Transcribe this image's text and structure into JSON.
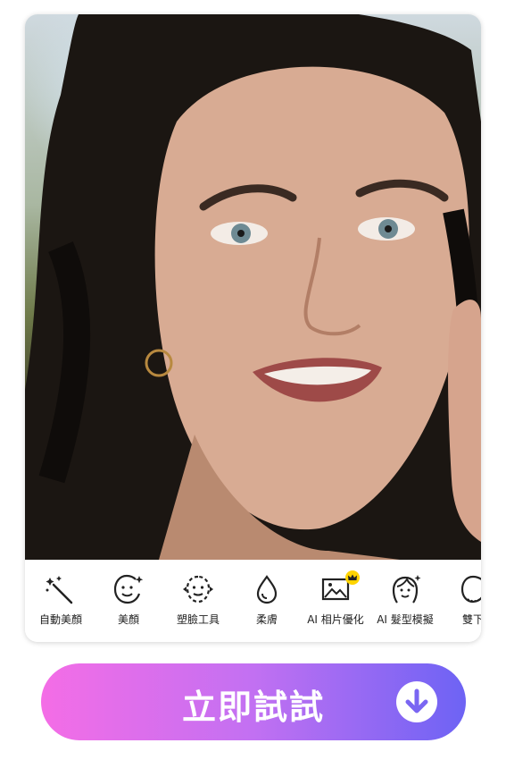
{
  "photo": {
    "description_icon": "portrait-photo"
  },
  "toolbar": {
    "tools": [
      {
        "label": "自動美顏",
        "icon": "magic-wand-icon"
      },
      {
        "label": "美顏",
        "icon": "face-sparkle-icon"
      },
      {
        "label": "塑臉工具",
        "icon": "face-reshape-icon"
      },
      {
        "label": "柔膚",
        "icon": "droplet-icon"
      },
      {
        "label": "AI 相片優化",
        "icon": "image-enhance-icon",
        "badge": "crown-icon"
      },
      {
        "label": "AI 髮型模擬",
        "icon": "hairstyle-icon"
      },
      {
        "label": "雙下",
        "icon": "double-chin-icon"
      }
    ]
  },
  "cta": {
    "label": "立即試試",
    "icon": "download-arrow-icon"
  },
  "colors": {
    "cta_gradient_start": "#f46de6",
    "cta_gradient_end": "#6d63f4",
    "crown_badge": "#ffd400"
  }
}
